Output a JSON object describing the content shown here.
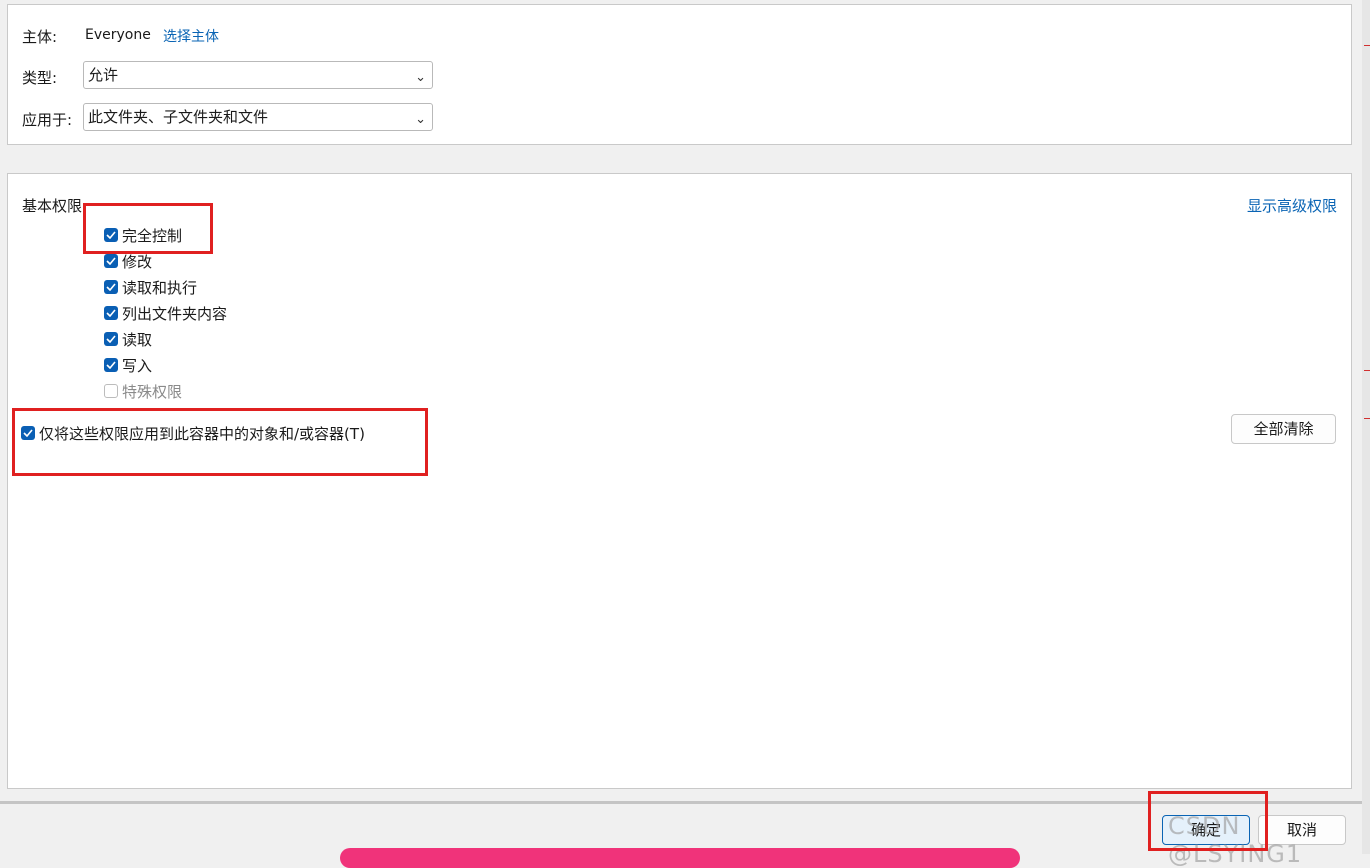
{
  "principal": {
    "label": "主体:",
    "name": "Everyone",
    "select_link": "选择主体"
  },
  "type_field": {
    "label": "类型:",
    "value": "允许"
  },
  "applies_field": {
    "label": "应用于:",
    "value": "此文件夹、子文件夹和文件"
  },
  "basic_permissions": {
    "title": "基本权限",
    "show_advanced_link": "显示高级权限",
    "items": [
      {
        "label": "完全控制",
        "checked": true,
        "enabled": true
      },
      {
        "label": "修改",
        "checked": true,
        "enabled": true
      },
      {
        "label": "读取和执行",
        "checked": true,
        "enabled": true
      },
      {
        "label": "列出文件夹内容",
        "checked": true,
        "enabled": true
      },
      {
        "label": "读取",
        "checked": true,
        "enabled": true
      },
      {
        "label": "写入",
        "checked": true,
        "enabled": true
      },
      {
        "label": "特殊权限",
        "checked": false,
        "enabled": false
      }
    ]
  },
  "apply_only": {
    "label": "仅将这些权限应用到此容器中的对象和/或容器(T)",
    "checked": true
  },
  "buttons": {
    "clear_all": "全部清除",
    "ok": "确定",
    "cancel": "取消"
  },
  "watermark": "CSDN @LSYING1",
  "colors": {
    "accent": "#0a5fb4",
    "link": "#0a64b4",
    "highlight_box": "#e02020"
  },
  "icons": {
    "chevron": "chevron-down-icon",
    "check": "checkmark-icon"
  }
}
